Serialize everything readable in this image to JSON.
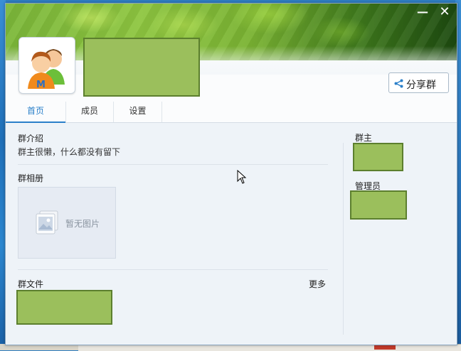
{
  "window": {
    "minimize_label": "—",
    "close_label": "✕"
  },
  "header": {
    "avatar_icon": "group-avatar-icon",
    "share_label": "分享群",
    "share_icon": "share-icon"
  },
  "tabs": [
    {
      "label": "首页",
      "active": true
    },
    {
      "label": "成员",
      "active": false
    },
    {
      "label": "设置",
      "active": false
    }
  ],
  "main": {
    "intro": {
      "title": "群介绍",
      "text": "群主很懒，什么都没有留下"
    },
    "album": {
      "title": "群相册",
      "empty_text": "暂无图片",
      "icon": "image-placeholder-icon"
    },
    "files": {
      "title": "群文件",
      "more_label": "更多"
    }
  },
  "sidebar": {
    "owner_title": "群主",
    "admin_title": "管理员"
  },
  "colors": {
    "accent": "#2a7fc9",
    "redaction_fill": "#9bbf5c",
    "redaction_border": "#5c7f2e"
  }
}
